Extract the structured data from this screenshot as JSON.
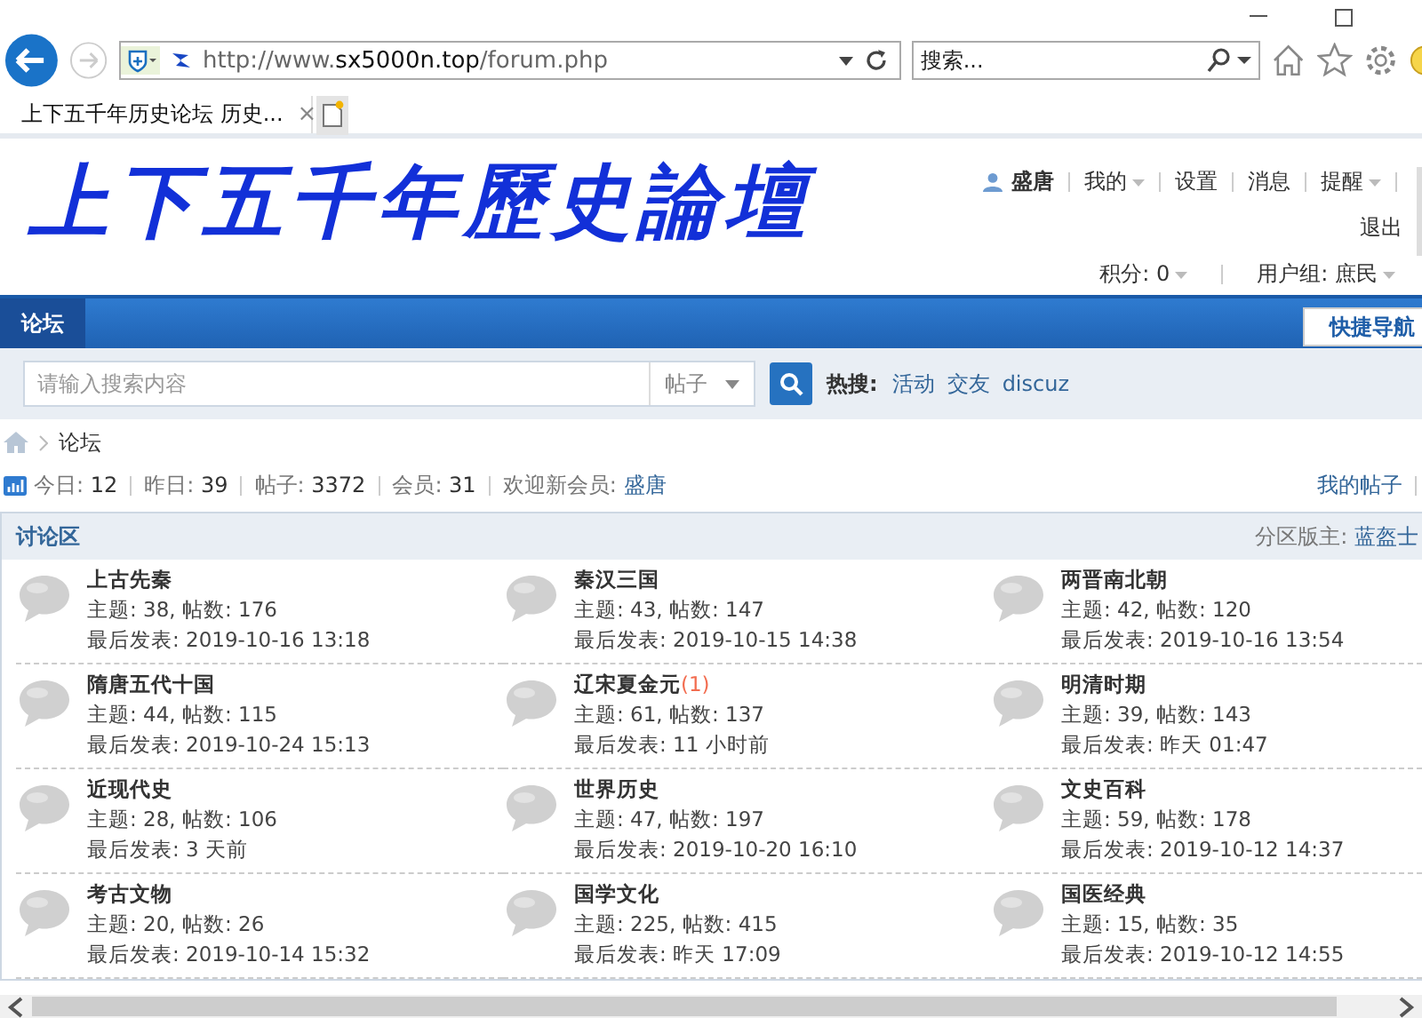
{
  "browser": {
    "url_host": "http://www.",
    "url_domain": "sx5000n.top",
    "url_path": "/forum.php",
    "search_placeholder": "搜索...",
    "tab_title": "上下五千年历史论坛 历史...",
    "tab_close": "×"
  },
  "header": {
    "logo": "上下五千年歷史論壇",
    "user": "盛唐",
    "user_links": [
      {
        "label": "我的",
        "dropdown": true
      },
      {
        "label": "设置",
        "dropdown": false
      },
      {
        "label": "消息",
        "dropdown": false
      },
      {
        "label": "提醒",
        "dropdown": true
      }
    ],
    "logout": "退出",
    "points": "积分: 0",
    "group": "用户组: 庶民"
  },
  "nav": {
    "items": [
      {
        "label": "论坛",
        "selected": true
      }
    ],
    "quick_nav": "快捷导航"
  },
  "search": {
    "placeholder": "请输入搜索内容",
    "type": "帖子",
    "hot_label": "热搜:",
    "hot": [
      "活动",
      "交友",
      "discuz"
    ]
  },
  "breadcrumb": "论坛",
  "stats": {
    "items": [
      {
        "label": "今日:",
        "value": "12"
      },
      {
        "label": "昨日:",
        "value": "39"
      },
      {
        "label": "帖子:",
        "value": "3372"
      },
      {
        "label": "会员:",
        "value": "31"
      }
    ],
    "new_member_label": "欢迎新会员:",
    "new_member": "盛唐",
    "my_posts": "我的帖子"
  },
  "section": {
    "title": "讨论区",
    "moderator_label": "分区版主:",
    "moderator": "蓝盔士"
  },
  "forums": [
    {
      "name": "上古先秦",
      "stats": "主题: 38, 帖数: 176",
      "last": "最后发表: 2019-10-16 13:18"
    },
    {
      "name": "秦汉三国",
      "stats": "主题: 43, 帖数: 147",
      "last": "最后发表: 2019-10-15 14:38"
    },
    {
      "name": "两晋南北朝",
      "stats": "主题: 42, 帖数: 120",
      "last": "最后发表: 2019-10-16 13:54"
    },
    {
      "name": "隋唐五代十国",
      "stats": "主题: 44, 帖数: 115",
      "last": "最后发表: 2019-10-24 15:13"
    },
    {
      "name": "辽宋夏金元",
      "new_count": "(1)",
      "stats": "主题: 61, 帖数: 137",
      "last": "最后发表: 11 小时前"
    },
    {
      "name": "明清时期",
      "stats": "主题: 39, 帖数: 143",
      "last": "最后发表: 昨天 01:47"
    },
    {
      "name": "近现代史",
      "stats": "主题: 28, 帖数: 106",
      "last": "最后发表: 3 天前"
    },
    {
      "name": "世界历史",
      "stats": "主题: 47, 帖数: 197",
      "last": "最后发表: 2019-10-20 16:10"
    },
    {
      "name": "文史百科",
      "stats": "主题: 59, 帖数: 178",
      "last": "最后发表: 2019-10-12 14:37"
    },
    {
      "name": "考古文物",
      "stats": "主题: 20, 帖数: 26",
      "last": "最后发表: 2019-10-14 15:32"
    },
    {
      "name": "国学文化",
      "stats": "主题: 225, 帖数: 415",
      "last": "最后发表: 昨天 17:09"
    },
    {
      "name": "国医经典",
      "stats": "主题: 15, 帖数: 35",
      "last": "最后发表: 2019-10-12 14:55"
    }
  ]
}
